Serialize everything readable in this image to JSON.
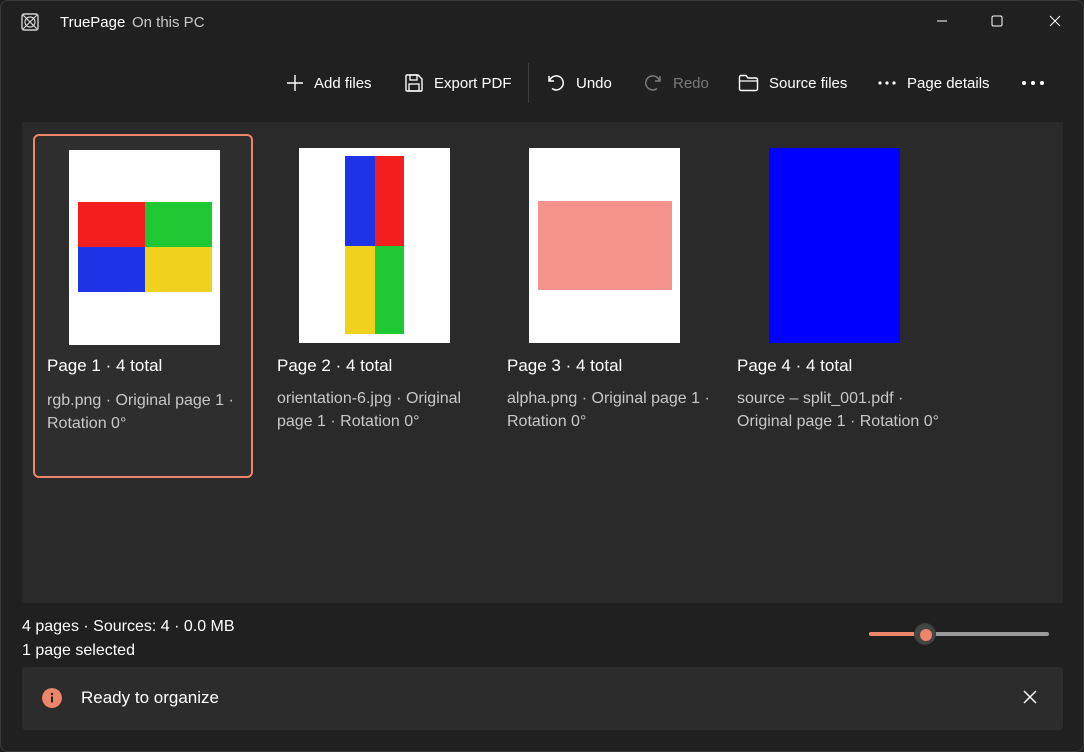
{
  "titlebar": {
    "title": "TruePage",
    "subtitle": "On this PC"
  },
  "toolbar": {
    "add_files": "Add files",
    "export_pdf": "Export PDF",
    "undo": "Undo",
    "redo": "Redo",
    "source_files": "Source files",
    "page_details": "Page details"
  },
  "pages": [
    {
      "title": "Page 1 · 4 total",
      "desc": "rgb.png · Original page 1 · Rotation 0°"
    },
    {
      "title": "Page 2 · 4 total",
      "desc": "orientation-6.jpg · Original page 1 · Rotation 0°"
    },
    {
      "title": "Page 3 · 4 total",
      "desc": "alpha.png · Original page 1 · Rotation 0°"
    },
    {
      "title": "Page 4 · 4 total",
      "desc": "source – split_001.pdf · Original page 1 · Rotation 0°"
    }
  ],
  "status": {
    "summary": "4 pages · Sources: 4 · 0.0 MB",
    "selection": "1 page selected"
  },
  "zoom": {
    "value": 0.31
  },
  "infobar": {
    "message": "Ready to organize"
  },
  "colors": {
    "accent": "#ec8569",
    "red": "#f41e1e",
    "green": "#1ec832",
    "blue": "#1e32e6",
    "yellow": "#f0d21e",
    "pink": "#f6938c",
    "pure_blue": "#0000ff"
  }
}
